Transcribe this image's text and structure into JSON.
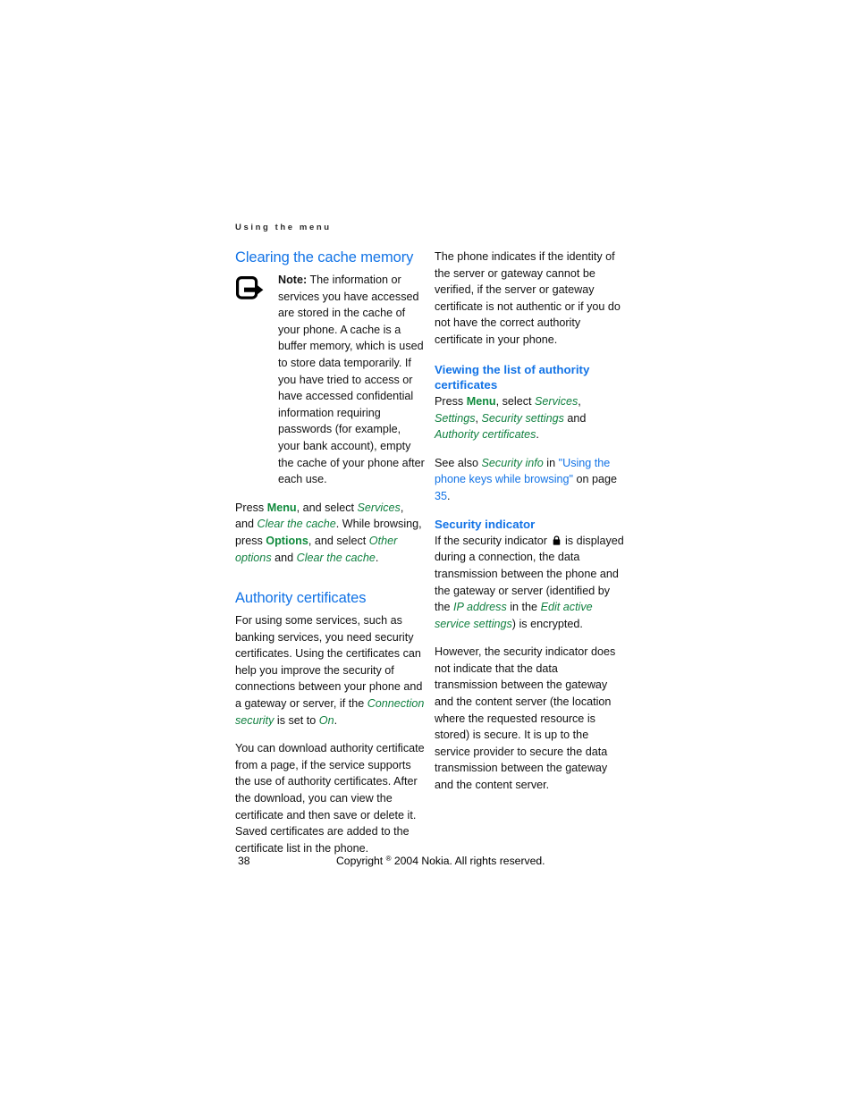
{
  "page": {
    "running_header": "Using the menu",
    "page_number": "38",
    "copyright": "Copyright © 2004 Nokia. All rights reserved.",
    "copyright_prefix": "Copyright",
    "copyright_symbol": "®",
    "copyright_suffix": "2004 Nokia. All rights reserved."
  },
  "colors": {
    "heading_blue": "#1273e6",
    "menu_green": "#118040",
    "body_black": "#111111"
  },
  "left_column": {
    "section_title": "Clearing the cache memory",
    "note": {
      "icon": "note-arrow-icon",
      "label": "Note:",
      "text": " The information or services you have accessed are stored in the cache of your phone. A cache is a buffer memory, which is used to store data temporarily. If you have tried to access or have accessed confidential information requiring passwords (for example, your bank account), empty the cache of your phone after each use."
    },
    "press_paragraph": {
      "t1": "Press ",
      "key1": "Menu",
      "t2": ", and select ",
      "item1": "Services",
      "t3": ", and ",
      "item2": "Clear the cache",
      "t4": ". While browsing, press ",
      "key2": "Options",
      "t5": ", and select ",
      "item3": "Other options",
      "t6": " and ",
      "item4": "Clear the cache",
      "t7": "."
    },
    "section_title_2": "Authority certificates",
    "paragraph_1": {
      "t1": "For using some services, such as banking services, you need security certificates. Using the certificates can help you improve the security of connections between your phone and a gateway or server, if the ",
      "item1": "Connection security",
      "t2": " is set to ",
      "item2": "On",
      "t3": "."
    },
    "paragraph_2": "You can download authority certificate from a page, if the service supports the use of authority certificates. After the download, you can view the certificate and then save or delete it. Saved certificates are added to the certificate list in the phone."
  },
  "right_column": {
    "paragraph_1": "The phone indicates if the identity of the server or gateway cannot be verified, if the server or gateway certificate is not authentic or if you do not have the correct authority certificate in your phone.",
    "sub_title_1": "Viewing the list of authority certificates",
    "press_paragraph": {
      "t1": "Press ",
      "key1": "Menu",
      "t2": ", select ",
      "item1": "Services",
      "t3": ", ",
      "item2": "Settings",
      "t4": ", ",
      "item3": "Security settings",
      "t5": " and ",
      "item4": "Authority certificates",
      "t6": "."
    },
    "see_also": {
      "t1": "See also ",
      "item1": "Security info",
      "t2": " in ",
      "xref": "\"Using the phone keys while browsing\"",
      "t3": " on page ",
      "page": "35",
      "t4": "."
    },
    "sub_title_2": "Security indicator",
    "indicator_paragraph": {
      "t1": "If the security indicator ",
      "icon": "padlock-icon",
      "t2": " is displayed during a connection, the data transmission between the phone and the gateway or server (identified by the ",
      "item1": "IP address",
      "t3": " in the ",
      "item2": "Edit active service settings",
      "t4": ") is encrypted."
    },
    "paragraph_2": "However, the security indicator does not indicate that the data transmission between the gateway and the content server (the location where the requested resource is stored) is secure. It is up to the service provider to secure the data transmission between the gateway and the content server."
  }
}
